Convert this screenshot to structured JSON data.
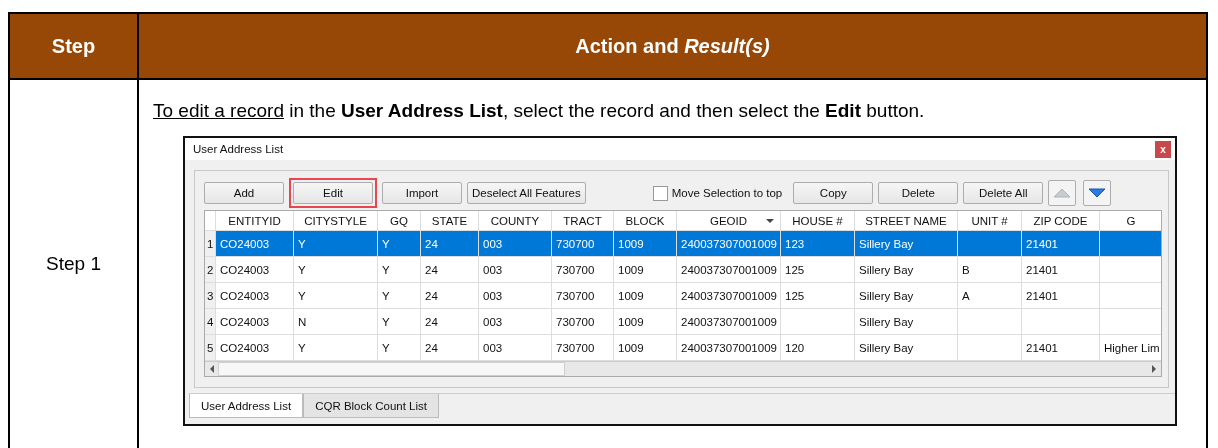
{
  "table": {
    "columns": [
      "Step",
      "Action and *Result(s)*"
    ],
    "rows": [
      {
        "step": "Step 1",
        "instruction": {
          "link": "To edit a record",
          "text": " in the **User Address List**, select the record and then select the **Edit** button."
        },
        "dialog": {
          "title": "User Address List",
          "close": "x",
          "toolbar": [
            {
              "kind": "button",
              "label": "Add",
              "highlighted": false
            },
            {
              "kind": "button",
              "label": "Edit",
              "highlighted": true
            },
            {
              "kind": "button",
              "label": "Import",
              "highlighted": false
            },
            {
              "kind": "button",
              "label": "Deselect All Features",
              "highlighted": false
            },
            {
              "kind": "checkbox",
              "label": "Move Selection to top",
              "checked": false
            },
            {
              "kind": "button",
              "label": "Copy",
              "highlighted": false
            },
            {
              "kind": "button",
              "label": "Delete",
              "highlighted": false
            },
            {
              "kind": "button",
              "label": "Delete All",
              "highlighted": false
            },
            {
              "kind": "raise",
              "disabled": true
            },
            {
              "kind": "lower",
              "disabled": false
            }
          ],
          "grid": {
            "columns": [
              {
                "label": "ENTITYID",
                "sorted": false
              },
              {
                "label": "CITYSTYLE",
                "sorted": false
              },
              {
                "label": "GQ",
                "sorted": false
              },
              {
                "label": "STATE",
                "sorted": false
              },
              {
                "label": "COUNTY",
                "sorted": false
              },
              {
                "label": "TRACT",
                "sorted": false
              },
              {
                "label": "BLOCK",
                "sorted": false
              },
              {
                "label": "GEOID",
                "sorted": true
              },
              {
                "label": "HOUSE #",
                "sorted": false
              },
              {
                "label": "STREET NAME",
                "sorted": false
              },
              {
                "label": "UNIT #",
                "sorted": false
              },
              {
                "label": "ZIP CODE",
                "sorted": false
              },
              {
                "label": "G",
                "sorted": false
              }
            ],
            "rows": [
              {
                "number": "1",
                "selected": true,
                "cells": [
                  "CO24003",
                  "Y",
                  "Y",
                  "24",
                  "003",
                  "730700",
                  "1009",
                  "240037307001009",
                  "123",
                  "Sillery Bay",
                  "",
                  "21401",
                  ""
                ]
              },
              {
                "number": "2",
                "selected": false,
                "cells": [
                  "CO24003",
                  "Y",
                  "Y",
                  "24",
                  "003",
                  "730700",
                  "1009",
                  "240037307001009",
                  "125",
                  "Sillery Bay",
                  "B",
                  "21401",
                  ""
                ]
              },
              {
                "number": "3",
                "selected": false,
                "cells": [
                  "CO24003",
                  "Y",
                  "Y",
                  "24",
                  "003",
                  "730700",
                  "1009",
                  "240037307001009",
                  "125",
                  "Sillery Bay",
                  "A",
                  "21401",
                  ""
                ]
              },
              {
                "number": "4",
                "selected": false,
                "cells": [
                  "CO24003",
                  "N",
                  "Y",
                  "24",
                  "003",
                  "730700",
                  "1009",
                  "240037307001009",
                  "",
                  "Sillery Bay",
                  "",
                  "",
                  ""
                ]
              },
              {
                "number": "5",
                "selected": false,
                "cells": [
                  "CO24003",
                  "Y",
                  "Y",
                  "24",
                  "003",
                  "730700",
                  "1009",
                  "240037307001009",
                  "120",
                  "Sillery Bay",
                  "",
                  "21401",
                  "Higher Lim"
                ]
              }
            ]
          },
          "tabs": [
            {
              "label": "User Address List",
              "selected": true
            },
            {
              "label": "CQR Block Count List",
              "selected": false
            }
          ]
        }
      }
    ]
  }
}
